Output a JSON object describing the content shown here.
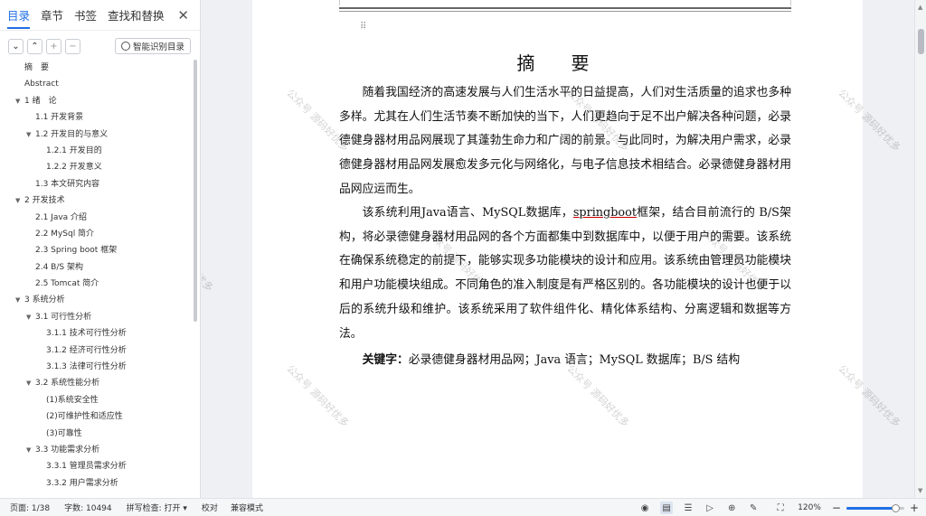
{
  "nav": {
    "tabs": [
      "目录",
      "章节",
      "书签",
      "查找和替换"
    ],
    "active_tab": 0,
    "smart_button": "智能识别目录",
    "toc": [
      {
        "label": "摘　要",
        "level": 0,
        "expand": ""
      },
      {
        "label": "Abstract",
        "level": 0,
        "expand": ""
      },
      {
        "label": "1 绪　论",
        "level": 0,
        "expand": "open"
      },
      {
        "label": "1.1 开发背景",
        "level": 1,
        "expand": ""
      },
      {
        "label": "1.2 开发目的与意义",
        "level": 1,
        "expand": "open"
      },
      {
        "label": "1.2.1 开发目的",
        "level": 2,
        "expand": ""
      },
      {
        "label": "1.2.2 开发意义",
        "level": 2,
        "expand": ""
      },
      {
        "label": "1.3 本文研究内容",
        "level": 1,
        "expand": ""
      },
      {
        "label": "2 开发技术",
        "level": 0,
        "expand": "open"
      },
      {
        "label": "2.1 Java 介绍",
        "level": 1,
        "expand": ""
      },
      {
        "label": "2.2 MySql 简介",
        "level": 1,
        "expand": ""
      },
      {
        "label": "2.3 Spring boot 框架",
        "level": 1,
        "expand": ""
      },
      {
        "label": "2.4 B/S 架构",
        "level": 1,
        "expand": ""
      },
      {
        "label": "2.5 Tomcat 简介",
        "level": 1,
        "expand": ""
      },
      {
        "label": "3 系统分析",
        "level": 0,
        "expand": "open"
      },
      {
        "label": "3.1 可行性分析",
        "level": 1,
        "expand": "open"
      },
      {
        "label": "3.1.1 技术可行性分析",
        "level": 2,
        "expand": ""
      },
      {
        "label": "3.1.2 经济可行性分析",
        "level": 2,
        "expand": ""
      },
      {
        "label": "3.1.3 法律可行性分析",
        "level": 2,
        "expand": ""
      },
      {
        "label": "3.2 系统性能分析",
        "level": 1,
        "expand": "open"
      },
      {
        "label": "(1)系统安全性",
        "level": 2,
        "expand": ""
      },
      {
        "label": "(2)可维护性和适应性",
        "level": 2,
        "expand": ""
      },
      {
        "label": "(3)可靠性",
        "level": 2,
        "expand": ""
      },
      {
        "label": "3.3 功能需求分析",
        "level": 1,
        "expand": "open"
      },
      {
        "label": "3.3.1 管理员需求分析",
        "level": 2,
        "expand": ""
      },
      {
        "label": "3.3.2 用户需求分析",
        "level": 2,
        "expand": ""
      }
    ]
  },
  "document": {
    "title": "摘　要",
    "para1": "随着我国经济的高速发展与人们生活水平的日益提高，人们对生活质量的追求也多种多样。尤其在人们生活节奏不断加快的当下，人们更趋向于足不出户解决各种问题，必录德健身器材用品网展现了其蓬勃生命力和广阔的前景。与此同时，为解决用户需求，必录德健身器材用品网发展愈发多元化与网络化，与电子信息技术相结合。必录德健身器材用品网应运而生。",
    "para2_a": "该系统利用Java语言、MySQL数据库，",
    "para2_link": "springboot",
    "para2_b": "框架，结合目前流行的 B/S架构，将必录德健身器材用品网的各个方面都集中到数据库中，以便于用户的需要。该系统在确保系统稳定的前提下，能够实现多功能模块的设计和应用。该系统由管理员功能模块和用户功能模块组成。不同角色的准入制度是有严格区别的。各功能模块的设计也便于以后的系统升级和维护。该系统采用了软件组件化、精化体系结构、分离逻辑和数据等方法。",
    "keywords_label": "关键字：",
    "keywords": "必录德健身器材用品网；Java 语言；MySQL 数据库；B/S 结构",
    "watermark": "公众号 源码好优多"
  },
  "status": {
    "page": "页面: 1/38",
    "words": "字数: 10494",
    "spellcheck": "拼写检查: 打开 ▾",
    "proof": "校对",
    "compat": "兼容模式",
    "zoom": "120%",
    "zoom_level": 0.85
  },
  "colors": {
    "accent": "#1f6fe5"
  }
}
